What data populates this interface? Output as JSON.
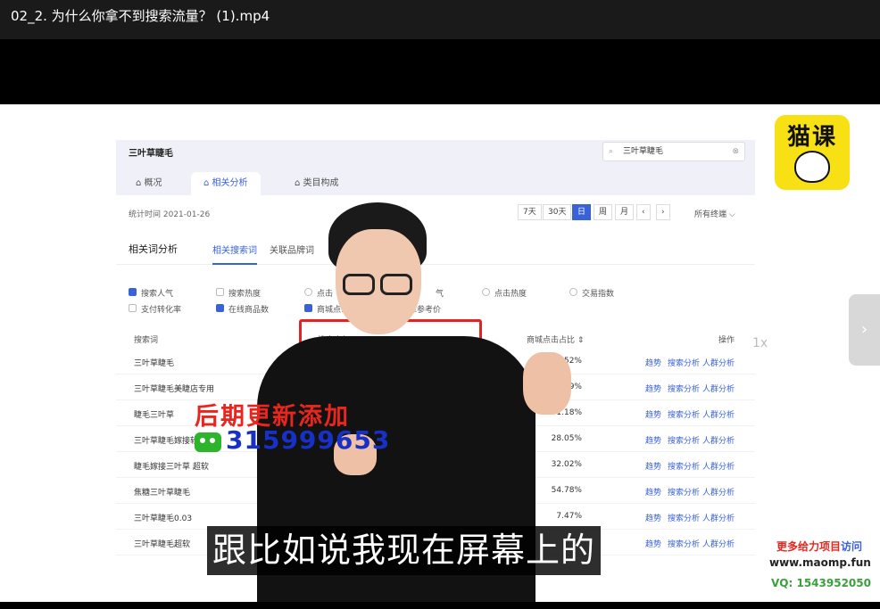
{
  "window": {
    "title": "02_2. 为什么你拿不到搜索流量？ (1).mp4"
  },
  "dashboard": {
    "title": "三叶草睫毛",
    "search_value": "三叶草睫毛",
    "tabs": [
      "概况",
      "相关分析",
      "类目构成"
    ],
    "stat_time": "统计时间 2021-01-26",
    "periods": [
      "7天",
      "30天",
      "日",
      "周",
      "月",
      "‹",
      "›"
    ],
    "terminal": "所有终端 ⌵",
    "section_title": "相关词分析",
    "sub_tabs": [
      "相关搜索词",
      "关联品牌词"
    ],
    "checkboxes": {
      "search_pop": "搜索人气",
      "search_heat": "搜索热度",
      "click_frag": "点击",
      "qi": "气",
      "click_heat": "点击热度",
      "trade_index": "交易指数",
      "pay_rate": "支付转化率",
      "online_goods": "在线商品数",
      "mall_click": "商城点击",
      "ref_price": "库参考价"
    },
    "headers": {
      "keyword": "搜索词",
      "search_pop": "搜索人气",
      "mall_click_ratio": "商城点击占比 ⇕",
      "actions": "操作"
    },
    "rows": [
      {
        "keyword": "三叶草睫毛",
        "pct": "35.52%"
      },
      {
        "keyword": "三叶草睫毛美睫店专用",
        "pct": "99%"
      },
      {
        "keyword": "睫毛三叶草",
        "pct": "1.18%"
      },
      {
        "keyword": "三叶草睫毛嫁接软",
        "pct": "28.05%"
      },
      {
        "keyword": "睫毛嫁接三叶草 超软",
        "pct": "32.02%"
      },
      {
        "keyword": "焦糖三叶草睫毛",
        "pct": "54.78%"
      },
      {
        "keyword": "三叶草睫毛0.03",
        "pct": "7.47%"
      },
      {
        "keyword": "三叶草睫毛超软",
        "pct": ""
      }
    ],
    "row_actions": [
      "趋势",
      "搜索分析",
      "人群分析"
    ]
  },
  "logo": {
    "text": "猫课"
  },
  "speed_indicator": "1x",
  "overlay": {
    "headline": "后期更新添加",
    "wechat_number": "315999653"
  },
  "subtitle": "跟比如说我现在屏幕上的",
  "watermark": {
    "line1_red": "更多给力项目",
    "line1_blue": "访问",
    "line2": "www.maomp.fun",
    "line3": "VQ: 1543952050"
  }
}
